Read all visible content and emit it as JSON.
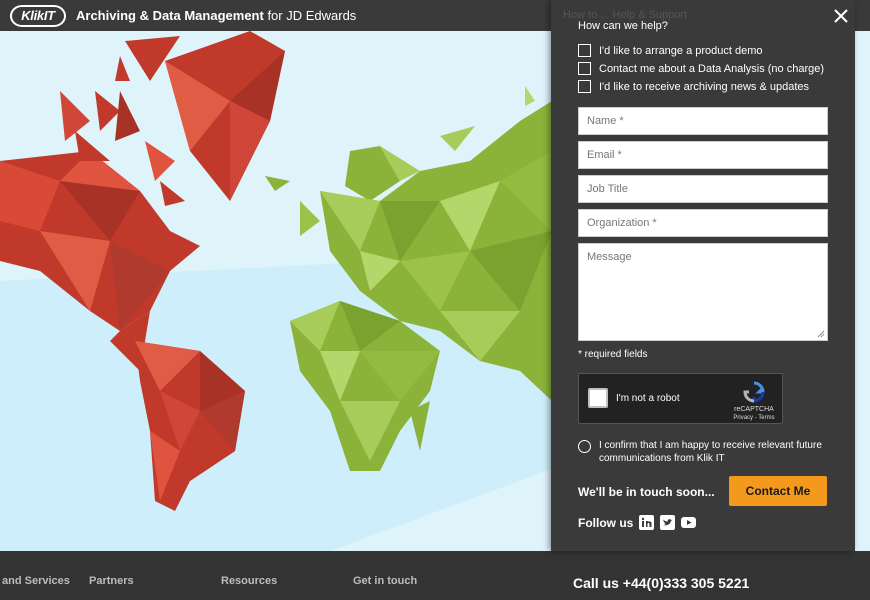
{
  "header": {
    "logo_text": "KlikIT",
    "title_bold": "Archiving & Data Management",
    "title_rest": " for JD Edwards"
  },
  "panel": {
    "ghost_text": "How to ... Help & Support",
    "help_label": "How can we help?",
    "options": [
      "I'd like to arrange a product demo",
      "Contact me about a Data Analysis (no charge)",
      "I'd like to receive archiving news & updates"
    ],
    "fields": {
      "name": "Name *",
      "email": "Email *",
      "job_title": "Job Title",
      "organization": "Organization *",
      "message": "Message"
    },
    "required_note": "* required fields",
    "captcha": {
      "label": "I'm not a robot",
      "brand": "reCAPTCHA",
      "links": "Privacy - Terms"
    },
    "consent": "I confirm that I am happy to receive relevant future communications from Klik IT",
    "touch_text": "We'll be in touch soon...",
    "contact_button": "Contact Me",
    "follow_label": "Follow us",
    "social_icons": [
      "linkedin-icon",
      "twitter-icon",
      "youtube-icon"
    ]
  },
  "footer": {
    "columns": [
      "and Services",
      "Partners",
      "Resources",
      "Get in touch"
    ],
    "phone": "Call us +44(0)333 305 5221"
  },
  "colors": {
    "header_bg": "#3a3a3a",
    "panel_bg": "#3a3a3a",
    "accent": "#f39a1c",
    "americas": "#c0392b",
    "africa_eurasia": "#8bb33a",
    "sea": "#dff3fb"
  }
}
